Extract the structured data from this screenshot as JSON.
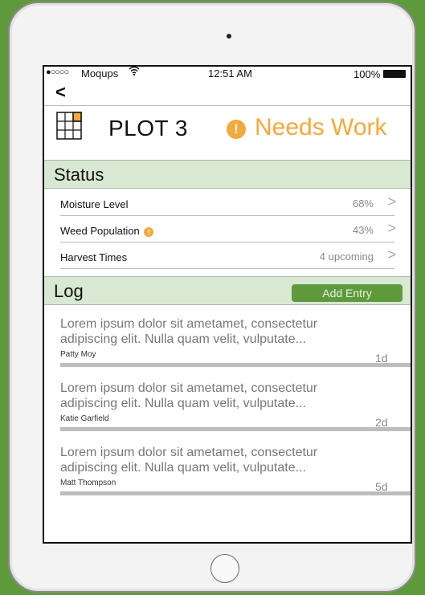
{
  "status_bar": {
    "signal": "●○○○○",
    "carrier": "Moqups",
    "wifi_icon": "wifi-icon",
    "time": "12:51 AM",
    "battery_pct": "100%"
  },
  "nav": {
    "back_label": "<"
  },
  "plot": {
    "title": "PLOT 3",
    "status_icon": "!",
    "status_label": "Needs Work"
  },
  "status_section": {
    "title": "Status",
    "rows": [
      {
        "label": "Moisture Level",
        "value": "68%",
        "warning": false
      },
      {
        "label": "Weed Population",
        "value": "43%",
        "warning": true
      },
      {
        "label": "Harvest Times",
        "value": "4 upcoming",
        "warning": false
      }
    ],
    "chevron": ">",
    "warning_icon": "!"
  },
  "log_section": {
    "title": "Log",
    "add_button": "Add Entry",
    "entries": [
      {
        "text": "Lorem ipsum dolor sit ametamet, consectetur adipiscing elit. Nulla quam velit, vulputate...",
        "author": "Patty Moy",
        "age": "1d"
      },
      {
        "text": "Lorem ipsum dolor sit ametamet, consectetur adipiscing elit. Nulla quam velit, vulputate...",
        "author": "Katie Garfield",
        "age": "2d"
      },
      {
        "text": "Lorem ipsum dolor sit ametamet, consectetur adipiscing elit. Nulla quam velit, vulputate...",
        "author": "Matt Thompson",
        "age": "5d"
      }
    ]
  },
  "colors": {
    "background_green": "#5e9a3c",
    "accent_orange": "#f4a93b",
    "header_green": "#d8e8d2"
  }
}
